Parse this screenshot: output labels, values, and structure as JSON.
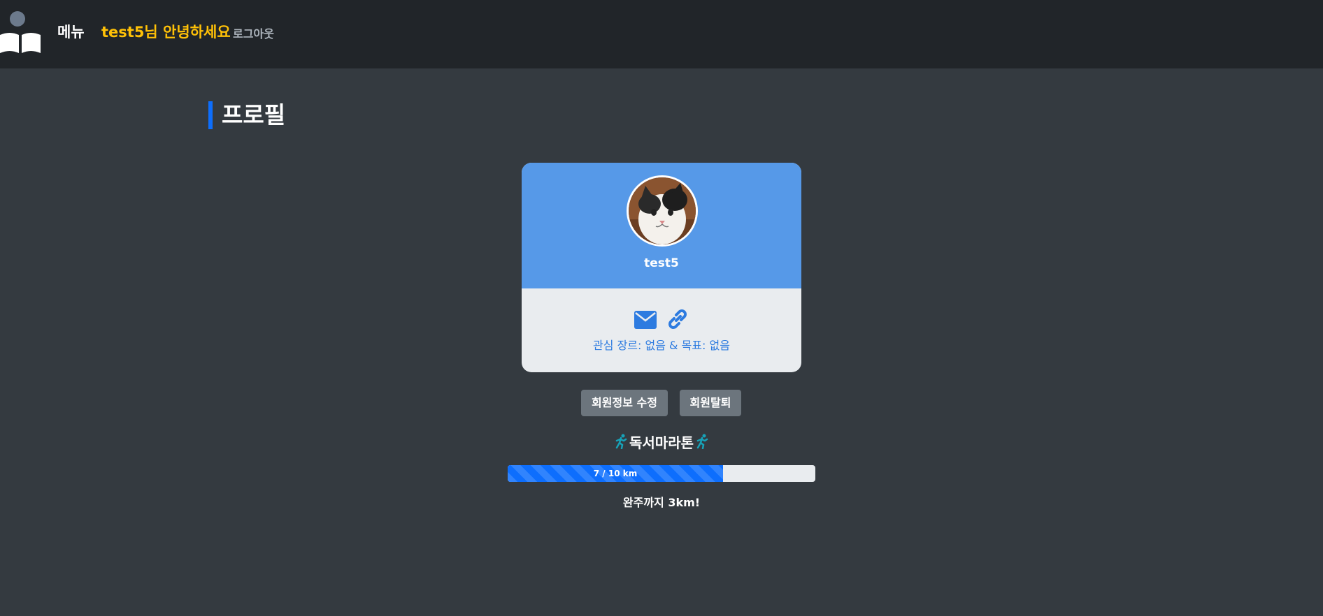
{
  "nav": {
    "menu_label": "메뉴",
    "greeting": "test5님 안녕하세요",
    "logout_label": "로그아웃"
  },
  "page": {
    "title": "프로필"
  },
  "profile": {
    "username": "test5",
    "interest_line": "관심 장르: 없음 & 목표: 없음"
  },
  "actions": {
    "edit_label": "회원정보 수정",
    "withdraw_label": "회원탈퇴"
  },
  "marathon": {
    "title": "독서마라톤",
    "progress_label": "7 / 10 km",
    "progress_fraction": 0.7,
    "remaining_text": "완주까지 3km!"
  },
  "colors": {
    "navbar": "#212529",
    "background": "#343a40",
    "accent": "#0d6efd",
    "greeting": "#ffc107",
    "card_header": "#5699e8",
    "runner": "#17a2b8"
  },
  "icons": [
    "book-reader-logo-icon",
    "mail-icon",
    "link-icon",
    "runner-icon"
  ]
}
